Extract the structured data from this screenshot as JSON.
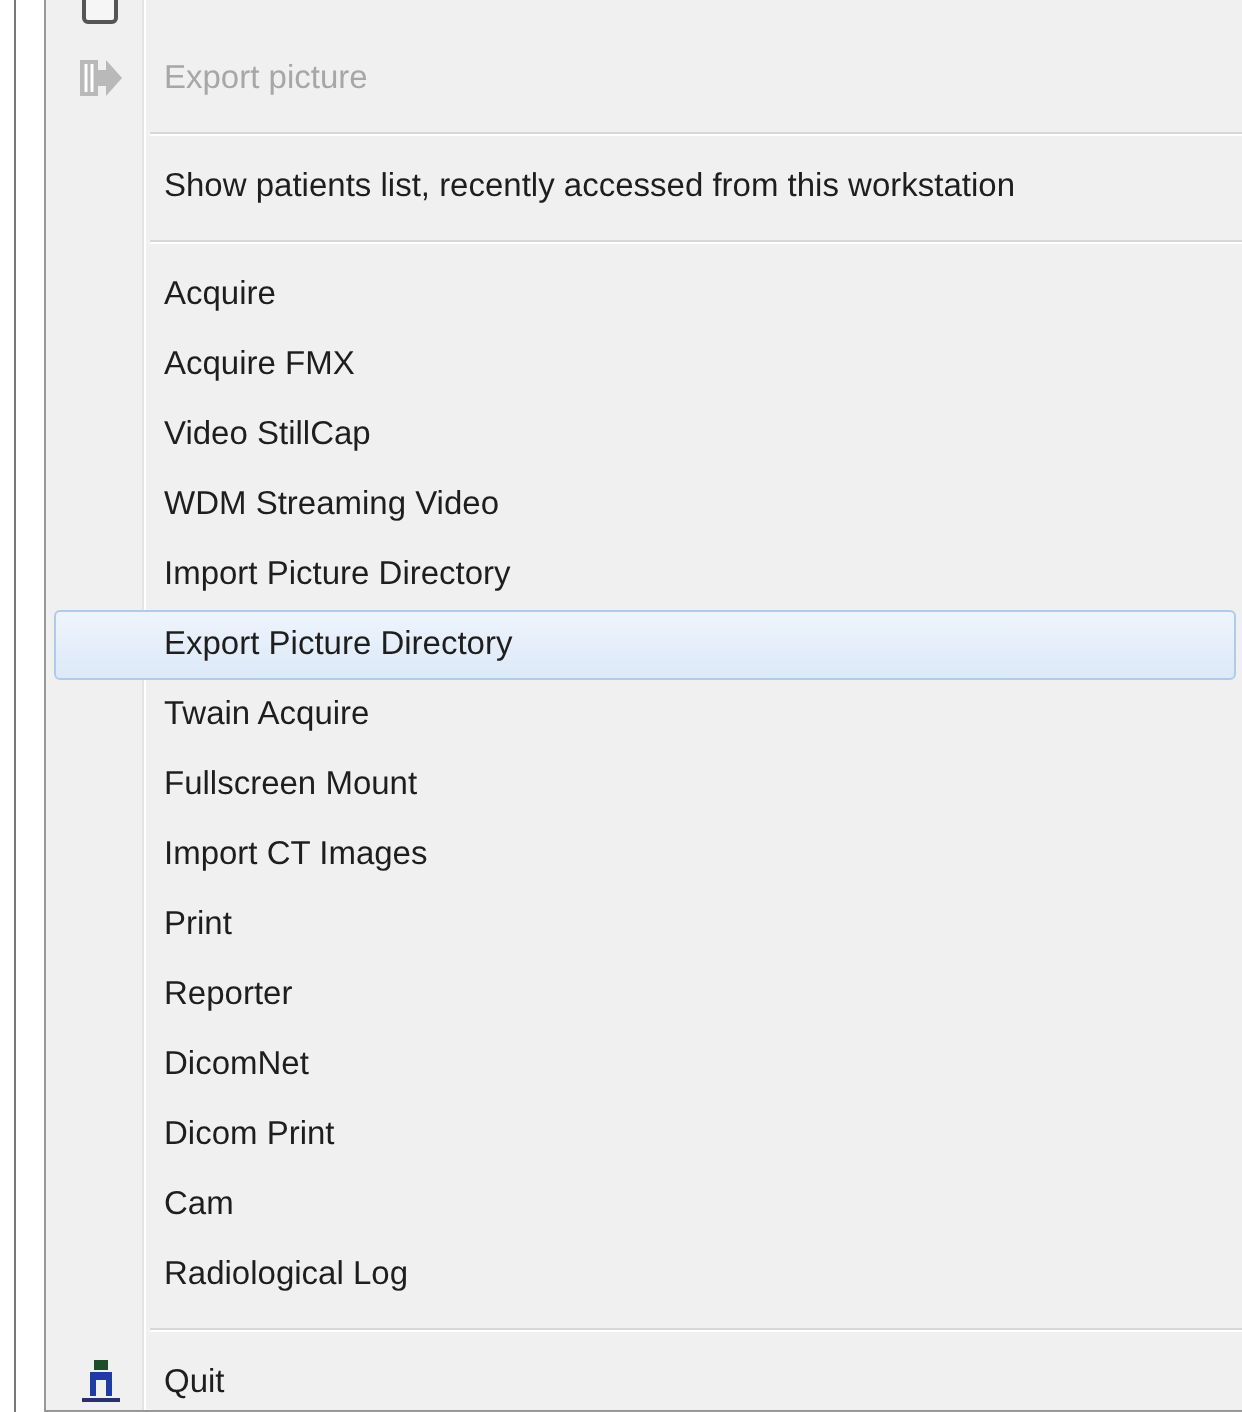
{
  "menu": {
    "items": [
      {
        "kind": "partial"
      },
      {
        "kind": "item",
        "label": "Export picture",
        "disabled": true,
        "selected": false
      },
      {
        "kind": "separator"
      },
      {
        "kind": "item",
        "label": "Show patients list, recently accessed from this workstation",
        "disabled": false,
        "selected": false
      },
      {
        "kind": "separator"
      },
      {
        "kind": "item",
        "label": "Acquire",
        "disabled": false,
        "selected": false
      },
      {
        "kind": "item",
        "label": "Acquire FMX",
        "disabled": false,
        "selected": false
      },
      {
        "kind": "item",
        "label": "Video StillCap",
        "disabled": false,
        "selected": false
      },
      {
        "kind": "item",
        "label": "WDM Streaming Video",
        "disabled": false,
        "selected": false
      },
      {
        "kind": "item",
        "label": "Import Picture Directory",
        "disabled": false,
        "selected": false
      },
      {
        "kind": "item",
        "label": "Export Picture Directory",
        "disabled": false,
        "selected": true
      },
      {
        "kind": "item",
        "label": "Twain Acquire",
        "disabled": false,
        "selected": false
      },
      {
        "kind": "item",
        "label": "Fullscreen Mount",
        "disabled": false,
        "selected": false
      },
      {
        "kind": "item",
        "label": "Import CT Images",
        "disabled": false,
        "selected": false
      },
      {
        "kind": "item",
        "label": "Print",
        "disabled": false,
        "selected": false
      },
      {
        "kind": "item",
        "label": "Reporter",
        "disabled": false,
        "selected": false
      },
      {
        "kind": "item",
        "label": "DicomNet",
        "disabled": false,
        "selected": false
      },
      {
        "kind": "item",
        "label": "Dicom Print",
        "disabled": false,
        "selected": false
      },
      {
        "kind": "item",
        "label": "Cam",
        "disabled": false,
        "selected": false
      },
      {
        "kind": "item",
        "label": "Radiological Log",
        "disabled": false,
        "selected": false
      },
      {
        "kind": "separator"
      },
      {
        "kind": "item",
        "label": "Quit",
        "disabled": false,
        "selected": false
      }
    ]
  }
}
